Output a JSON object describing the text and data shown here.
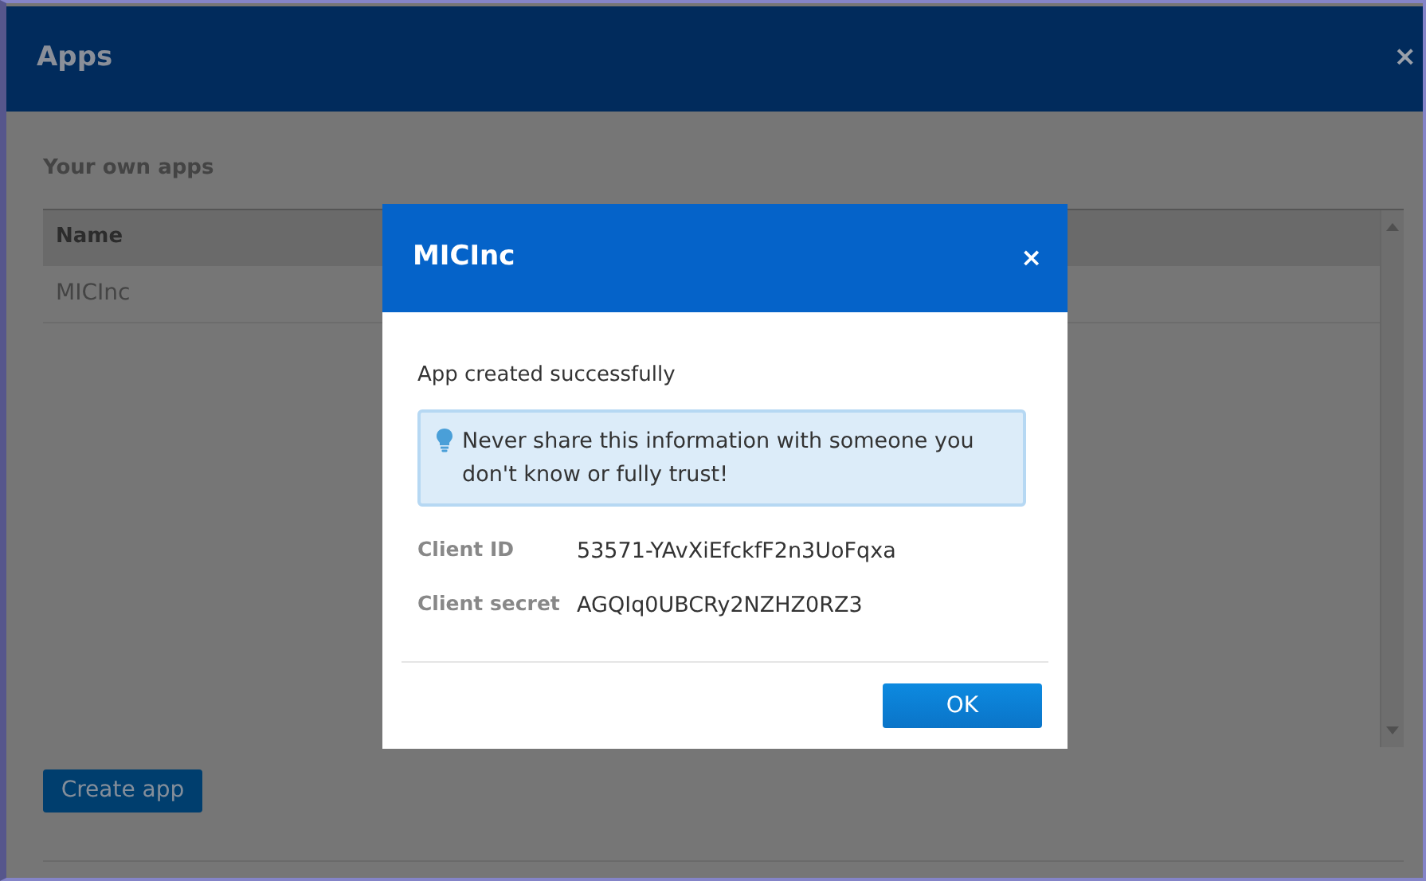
{
  "window": {
    "title": "Apps",
    "close": "×"
  },
  "section_title": "Your own apps",
  "table": {
    "columns": [
      "Name"
    ],
    "rows": [
      [
        "MICInc"
      ]
    ]
  },
  "create_button": "Create app",
  "modal": {
    "title": "MICInc",
    "close": "×",
    "message": "App created successfully",
    "alert": "Never share this information with someone you don't know or fully trust!",
    "fields": [
      {
        "label": "Client ID",
        "value": "53571-YAvXiEfckfF2n3UoFqxa"
      },
      {
        "label": "Client secret",
        "value": "AGQIq0UBCRy2NZHZ0RZ3"
      }
    ],
    "ok_button": "OK"
  }
}
